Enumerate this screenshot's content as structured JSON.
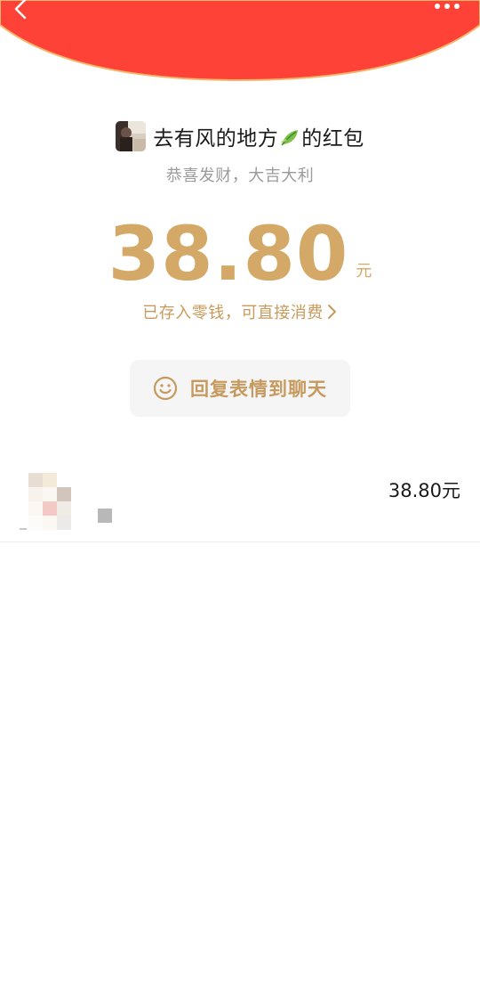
{
  "header": {
    "back_icon": "chevron-left-icon",
    "more_icon": "more-dots-icon",
    "banner_color": "#ff4237",
    "banner_rim_color": "#f2b76c"
  },
  "packet": {
    "title_before_emoji": "去有风的地方",
    "title_emoji": "leaf-icon",
    "title_after_emoji": "的红包",
    "blessing": "恭喜发财，大吉大利",
    "amount": "38.80",
    "unit": "元",
    "saved_text": "已存入零钱，可直接消费",
    "accent_color": "#d4a866"
  },
  "actions": {
    "reply_icon": "smile-icon",
    "reply_label": "回复表情到聊天"
  },
  "records": [
    {
      "amount": "38.80元"
    }
  ]
}
